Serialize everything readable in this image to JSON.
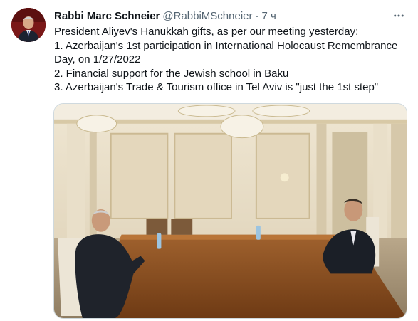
{
  "tweet": {
    "author_name": "Rabbi Marc Schneier",
    "author_handle": "@RabbiMSchneier",
    "separator": "·",
    "time": "7 ч",
    "more_icon": "more-horizontal-icon",
    "text_lines": [
      "President Aliyev's Hanukkah gifts, as per our meeting yesterday:",
      "1. Azerbaijan's 1st participation in International Holocaust Remembrance",
      "Day, on 1/27/2022",
      "2. Financial support for the Jewish school in Baku",
      "3. Azerbaijan's Trade & Tourism office in Tel Aviv is \"just the 1st step\""
    ]
  },
  "colors": {
    "text": "#0f1419",
    "secondary": "#536471",
    "border": "#cfd9de",
    "table": "#8a4a1f",
    "wall": "#e8dcc3"
  }
}
